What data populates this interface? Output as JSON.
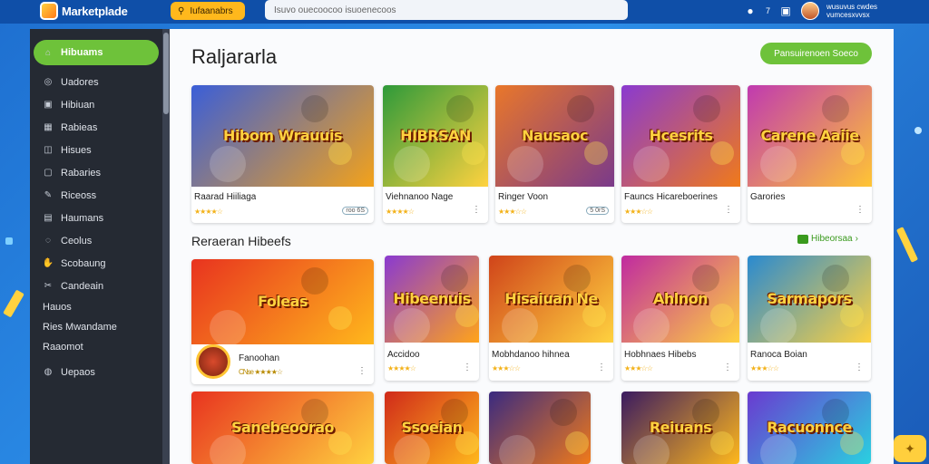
{
  "app": {
    "title": "Marketplade"
  },
  "header": {
    "category_button": "Iufaanabrs",
    "search_placeholder": "Isuvo ouecoocoo isuoenecoos",
    "notif_count": "7",
    "user_line1": "wusuvus cwdes",
    "user_line2": "vumcesxvvsx"
  },
  "sidebar": {
    "items": [
      {
        "label": "Hibuams",
        "icon": "home-icon",
        "active": true
      },
      {
        "label": "Uadores",
        "icon": "compass-icon"
      },
      {
        "label": "Hibiuan",
        "icon": "image-icon"
      },
      {
        "label": "Rabieas",
        "icon": "grid-icon"
      },
      {
        "label": "Hisues",
        "icon": "box-icon"
      },
      {
        "label": "Rabaries",
        "icon": "square-icon"
      },
      {
        "label": "Riceoss",
        "icon": "pencil-icon"
      },
      {
        "label": "Haumans",
        "icon": "calendar-icon"
      },
      {
        "label": "Ceolus",
        "icon": "chat-icon"
      },
      {
        "label": "Scobaung",
        "icon": "hand-icon"
      },
      {
        "label": "Candeain",
        "icon": "tool-icon"
      }
    ],
    "plain_items": [
      "Hauos",
      "Ries Mwandame",
      "Raaomot"
    ],
    "last_item": {
      "label": "Uepaos",
      "icon": "globe-icon"
    }
  },
  "main": {
    "title": "Raljararla",
    "top_button": "Pansuirenoen Soeco",
    "row1": [
      {
        "thumb": "Hibom Wrauuis",
        "name": "Raarad Hiiliaga",
        "stars": "★★★★☆",
        "tag": "roo 6S",
        "colors": [
          "#3a5ed8",
          "#f3a21a"
        ]
      },
      {
        "thumb": "HIBRSAN",
        "name": "Viehnanoo Nage",
        "stars": "★★★★☆",
        "tag": "",
        "colors": [
          "#2e9a3a",
          "#ffd23f"
        ]
      },
      {
        "thumb": "Nausaoc",
        "name": "Ringer Voon",
        "stars": "★★★☆☆",
        "tag": "5 0rS",
        "colors": [
          "#e9772a",
          "#7a3a8a"
        ]
      },
      {
        "thumb": "Hcesrits",
        "name": "Fauncs Hicareboerines",
        "stars": "★★★☆☆",
        "tag": "",
        "colors": [
          "#8a3ad0",
          "#f07a1a"
        ]
      },
      {
        "thumb": "Carene Aaiie",
        "name": "Garories",
        "stars": "",
        "tag": "",
        "colors": [
          "#c03ab0",
          "#ffc534"
        ]
      }
    ],
    "section_title": "Reraeran Hibeefs",
    "section_link": "Hibeorsaa",
    "row2": [
      {
        "thumb": "Foleas",
        "name": "Fanoohan",
        "sub": "CNse ★★★★☆",
        "colors": [
          "#e8331f",
          "#ffb81c"
        ]
      },
      {
        "thumb": "Hibeenuis",
        "name": "Accidoo",
        "stars": "★★★★☆",
        "colors": [
          "#8a3ad0",
          "#ffa31a"
        ]
      },
      {
        "thumb": "Hisaiuan Ne",
        "name": "Mobhdanoo hihnea",
        "stars": "★★★☆☆",
        "colors": [
          "#d0441a",
          "#ffd23f"
        ]
      },
      {
        "thumb": "Ahlnon",
        "name": "Hobhnaes Hibebs",
        "stars": "★★★☆☆",
        "colors": [
          "#c02aa0",
          "#ffd23f"
        ]
      },
      {
        "thumb": "Sarmapors",
        "name": "Ranoca Boian",
        "stars": "★★★☆☆",
        "colors": [
          "#2a8ad0",
          "#ffd23f"
        ]
      }
    ],
    "row3": [
      {
        "thumb": "Sanebeoorao",
        "colors": [
          "#e8331f",
          "#ffd23f"
        ]
      },
      {
        "thumb": "Ssoeian",
        "colors": [
          "#d02a1a",
          "#ffb81c"
        ]
      },
      {
        "thumb": "",
        "colors": [
          "#3a2a80",
          "#f07a1a"
        ]
      },
      {
        "thumb": "Reiuans",
        "colors": [
          "#3a1a60",
          "#ffb81c"
        ]
      },
      {
        "thumb": "Racuonnce",
        "colors": [
          "#6a3ad0",
          "#2ad0e0"
        ]
      }
    ]
  }
}
